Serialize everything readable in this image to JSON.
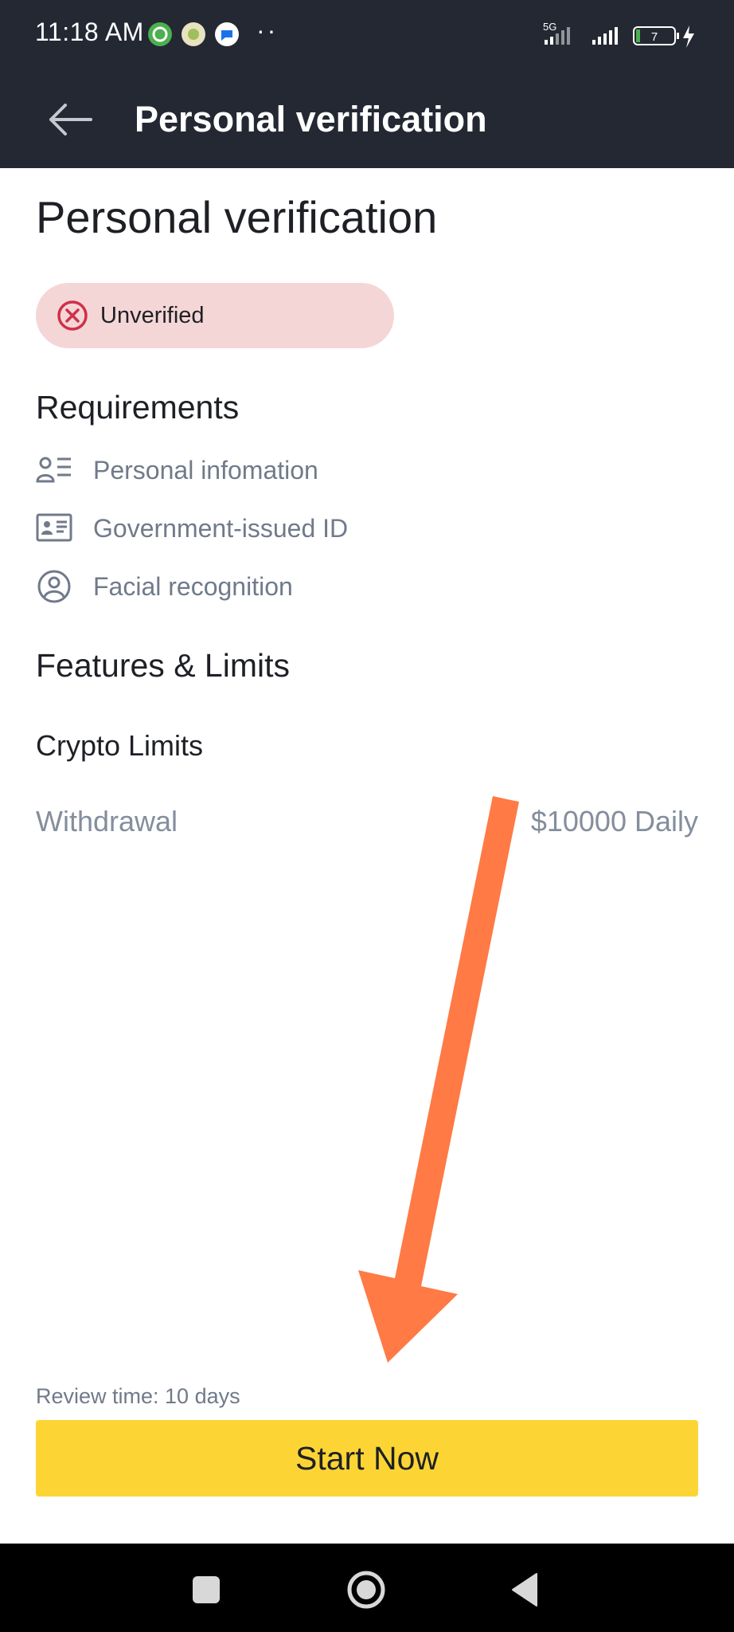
{
  "status_bar": {
    "time": "11:18 AM",
    "dots": "··",
    "network": "5G",
    "battery": "7"
  },
  "app_bar": {
    "title": "Personal verification"
  },
  "page": {
    "title": "Personal verification",
    "status_badge": "Unverified",
    "requirements_heading": "Requirements",
    "requirements": [
      {
        "label": "Personal infomation",
        "icon": "person-info-icon"
      },
      {
        "label": "Government-issued ID",
        "icon": "id-card-icon"
      },
      {
        "label": "Facial recognition",
        "icon": "face-icon"
      }
    ],
    "features_heading": "Features & Limits",
    "crypto_limits_heading": "Crypto Limits",
    "withdrawal_label": "Withdrawal",
    "withdrawal_value": "$10000 Daily"
  },
  "footer": {
    "review_time": "Review time: 10 days",
    "start_button": "Start Now"
  },
  "colors": {
    "header_bg": "#242833",
    "badge_bg": "#f5d6d6",
    "error_red": "#cf304a",
    "primary_yellow": "#fcd535",
    "annotation_arrow": "#ff7a45"
  }
}
